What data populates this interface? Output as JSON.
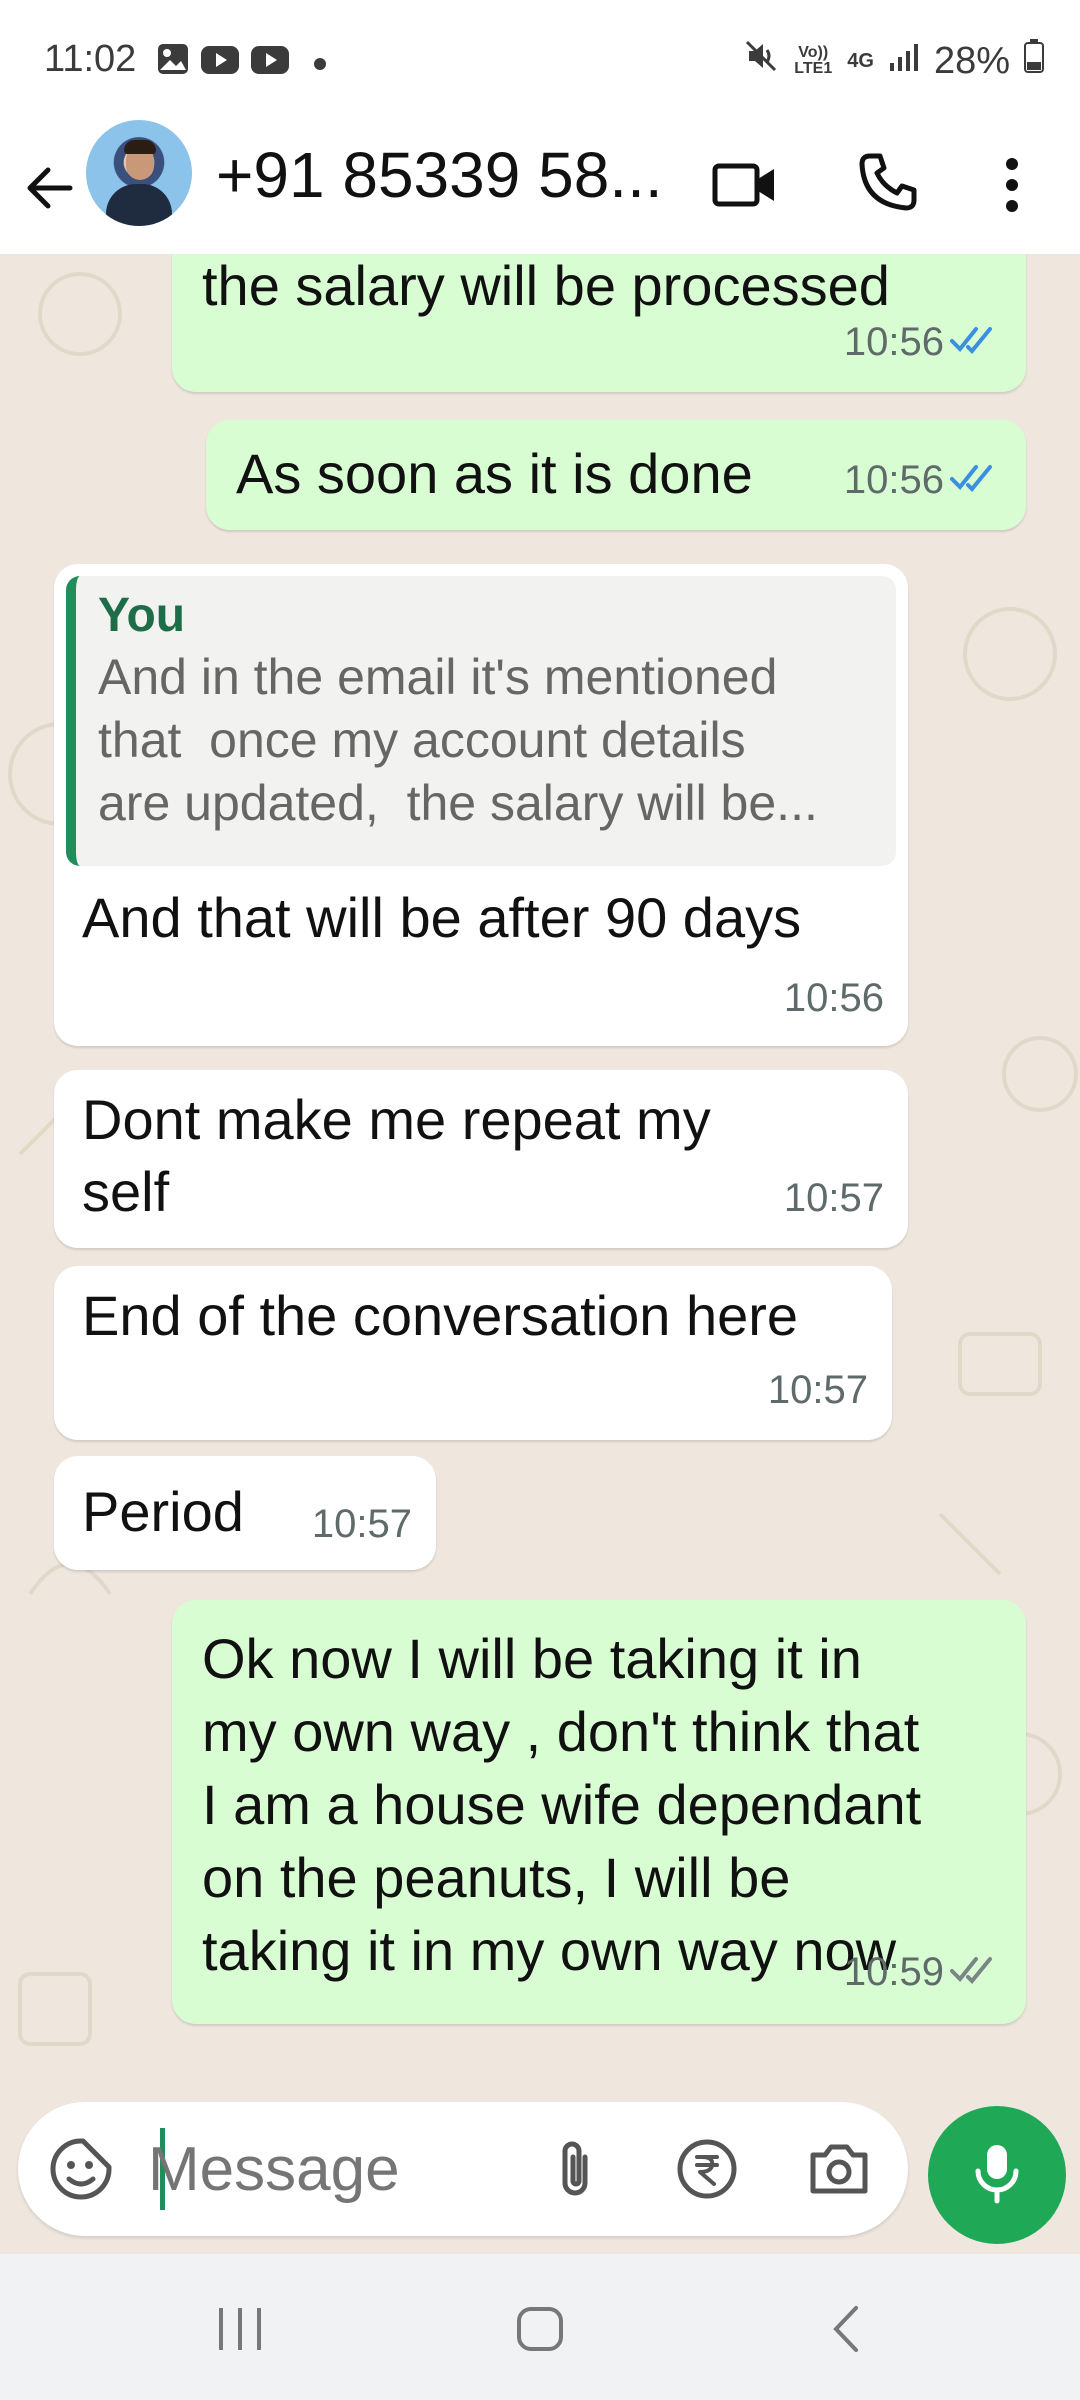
{
  "status_bar": {
    "time": "11:02",
    "network_label": "Vo)) LTE1",
    "network_type": "4G",
    "battery": "28%",
    "icons": [
      "gallery-icon",
      "youtube-icon",
      "youtube-icon",
      "notification-dot-icon",
      "mute-icon",
      "signal-icon",
      "battery-icon"
    ]
  },
  "header": {
    "contact_name": "+91 85339 58...",
    "icons": [
      "back-arrow-icon",
      "video-call-icon",
      "phone-icon",
      "more-options-icon"
    ]
  },
  "messages": [
    {
      "direction": "out",
      "text": "the salary will be processed",
      "time": "10:56",
      "status": "read"
    },
    {
      "direction": "out",
      "text": "As soon as it is done",
      "time": "10:56",
      "status": "read"
    },
    {
      "direction": "in",
      "quote": {
        "author": "You",
        "text": "And in the email it's mentioned\nthat  once my account details\nare updated,  the salary will be..."
      },
      "text": "And that will be after 90 days",
      "time": "10:56"
    },
    {
      "direction": "in",
      "text": "Dont make me repeat my\nself",
      "time": "10:57"
    },
    {
      "direction": "in",
      "text": "End of the conversation here",
      "time": "10:57"
    },
    {
      "direction": "in",
      "text": "Period",
      "time": "10:57"
    },
    {
      "direction": "out",
      "text": "Ok now I will be taking it in\nmy own way , don't think that\nI am a house wife dependant\non the peanuts, I will be\ntaking it in my own way now",
      "time": "10:59",
      "status": "delivered"
    }
  ],
  "composer": {
    "placeholder": "Message",
    "icons": [
      "sticker-icon",
      "attach-icon",
      "payment-icon",
      "camera-icon",
      "mic-icon"
    ]
  },
  "colors": {
    "outgoing_bubble": "#d9fdd3",
    "incoming_bubble": "#ffffff",
    "chat_background": "#efe7de",
    "accent": "#1fa855",
    "read_tick": "#3a8fe0"
  }
}
